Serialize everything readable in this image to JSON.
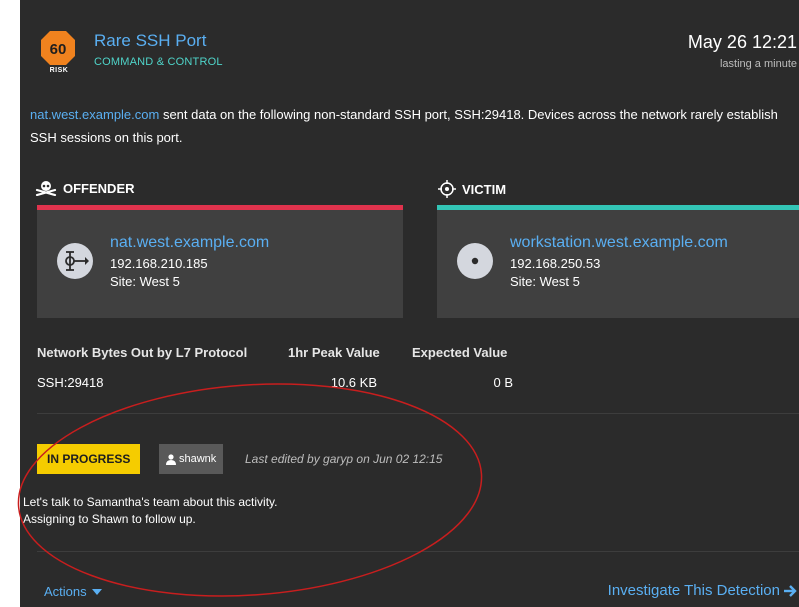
{
  "detection": {
    "risk_score": "60",
    "risk_label": "RISK",
    "title": "Rare SSH Port",
    "category": "COMMAND & CONTROL",
    "date": "May 26 12:21",
    "duration": "lasting a minute",
    "description_link": "nat.west.example.com",
    "description_text": " sent data on the following non-standard SSH port, SSH:29418. Devices across the network rarely establish SSH sessions on this port."
  },
  "offender": {
    "heading": "OFFENDER",
    "name": "nat.west.example.com",
    "ip": "192.168.210.185",
    "site": "Site: West 5"
  },
  "victim": {
    "heading": "VICTIM",
    "name": "workstation.west.example.com",
    "ip": "192.168.250.53",
    "site": "Site: West 5"
  },
  "metrics": {
    "headers": [
      "Network Bytes Out by L7 Protocol",
      "1hr Peak Value",
      "Expected Value"
    ],
    "rows": [
      [
        "SSH:29418",
        "10.6 KB",
        "0 B"
      ]
    ]
  },
  "tracking": {
    "status": "IN PROGRESS",
    "assignee": "shawnk",
    "last_edited": "Last edited by garyp on Jun 02 12:15",
    "note_lines": [
      "Let's talk to Samantha's team about this activity.",
      "Assigning to Shawn to follow up."
    ]
  },
  "footer": {
    "actions_label": "Actions",
    "investigate_label": "Investigate This Detection"
  },
  "colors": {
    "panel_bg": "#2b2b2b",
    "link": "#5aaff2",
    "category": "#4fd4c9",
    "risk_orange": "#f0821e",
    "offender_red": "#e0334d",
    "victim_teal": "#33c5b6",
    "status_yellow": "#f5cc00",
    "annotation_red": "#c81e1e"
  }
}
